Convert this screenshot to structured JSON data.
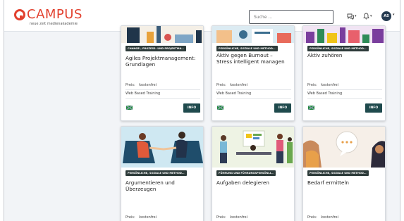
{
  "header": {
    "logo_text": "CAMPUS",
    "logo_tagline": "neue zeit medienakademie",
    "search_placeholder": "Suche ...",
    "avatar_initials": "AS"
  },
  "courses": [
    {
      "tag": "CHANGE-, PROZESS- UND PROJEKTMA…",
      "title": "Agiles Projektmanagement: Grundlagen",
      "price_label": "Preis:",
      "price_value": "kostenfrei",
      "format": "Web Based Training",
      "info_label": "INFO"
    },
    {
      "tag": "PERSÖNLICHE, SOZIALE UND METHOD…",
      "title": "Aktiv gegen Burnout – Stress intelligent managen",
      "price_label": "Preis:",
      "price_value": "kostenfrei",
      "format": "Web Based Training",
      "info_label": "INFO"
    },
    {
      "tag": "PERSÖNLICHE, SOZIALE UND METHOD…",
      "title": "Aktiv zuhören",
      "price_label": "Preis:",
      "price_value": "kostenfrei",
      "format": "Web Based Training",
      "info_label": "INFO"
    },
    {
      "tag": "PERSÖNLICHE, SOZIALE UND METHOD…",
      "title": "Argumentieren und Überzeugen",
      "price_label": "Preis:",
      "price_value": "kostenfrei"
    },
    {
      "tag": "FÜHRUNG UND FÜHRUNGSPERSÖNLI…",
      "title": "Aufgaben delegieren",
      "price_label": "Preis:",
      "price_value": "kostenfrei"
    },
    {
      "tag": "PERSÖNLICHE, SOZIALE UND METHOD…",
      "title": "Bedarf ermitteln",
      "price_label": "Preis:",
      "price_value": "kostenfrei"
    }
  ],
  "colors": {
    "brand": "#e2402e",
    "tag_bg": "#2d3b3a",
    "info_bg": "#1f4a4d",
    "avatar_bg": "#263b50"
  }
}
